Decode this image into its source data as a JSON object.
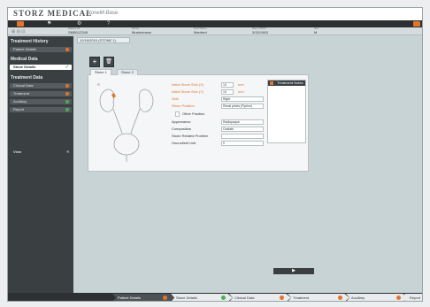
{
  "brand": {
    "name": "STORZ MEDICAL",
    "product": "StoneM-Base"
  },
  "patient": {
    "fields": [
      {
        "label": "Patient ID",
        "value": "SMB012345"
      },
      {
        "label": "Name",
        "value": "Mustermann"
      },
      {
        "label": "First Name",
        "value": "Manfred"
      },
      {
        "label": "Day of Birth",
        "value": "3/15/1963"
      },
      {
        "label": "Sex",
        "value": "M"
      }
    ]
  },
  "sidebar": {
    "sections": [
      {
        "title": "Treatment History",
        "items": [
          {
            "label": "Patient Details",
            "status": "orange",
            "active": false
          }
        ]
      },
      {
        "title": "Medical Data",
        "items": [
          {
            "label": "Stone Details",
            "status": "check",
            "active": true
          }
        ]
      },
      {
        "title": "Treatment Data",
        "items": [
          {
            "label": "Clinical Data",
            "status": "orange",
            "active": false
          },
          {
            "label": "Treatment",
            "status": "orange",
            "active": false
          },
          {
            "label": "Auxiliary",
            "status": "green",
            "active": false
          },
          {
            "label": "Report",
            "status": "green",
            "active": false
          }
        ]
      },
      {
        "title": "View",
        "items": []
      }
    ]
  },
  "main": {
    "tab_label": "12/16/2010 (STONE 1)",
    "stone_tabs": [
      "Stone 1",
      "Stone 2"
    ],
    "fields": [
      {
        "label": "Initial Stone Size (X)",
        "value": "10",
        "unit": "mm",
        "required": true
      },
      {
        "label": "Initial Stone Size (Y)",
        "value": "10",
        "unit": "mm",
        "required": true
      },
      {
        "label": "Side",
        "value": "Right",
        "unit": "",
        "required": true
      },
      {
        "label": "Stone Position",
        "value": "Renal pelvis (Pyelon)",
        "unit": "",
        "required": true
      },
      {
        "label": "Other Position",
        "value": "",
        "unit": "",
        "required": false
      },
      {
        "label": "Appearance",
        "value": "Radiopaque",
        "unit": "",
        "required": false
      },
      {
        "label": "Composition",
        "value": "Oxalate",
        "unit": "",
        "required": false
      },
      {
        "label": "Stone Related Problem",
        "value": "",
        "unit": "",
        "required": false
      },
      {
        "label": "Hounsfield Unit",
        "value": "0",
        "unit": "",
        "required": false
      }
    ],
    "notes_title": "Treatment Notes",
    "next_label": "▶"
  },
  "workflow": [
    {
      "label": "Patient Details",
      "status": "orange"
    },
    {
      "label": "Stone Details",
      "status": "check"
    },
    {
      "label": "Clinical Data",
      "status": "orange"
    },
    {
      "label": "Treatment",
      "status": "orange"
    },
    {
      "label": "Auxiliary",
      "status": "orange"
    },
    {
      "label": "Report",
      "status": "orange"
    }
  ],
  "colors": {
    "accent": "#e4742b",
    "ok": "#4caf50",
    "dark": "#2c3033"
  }
}
